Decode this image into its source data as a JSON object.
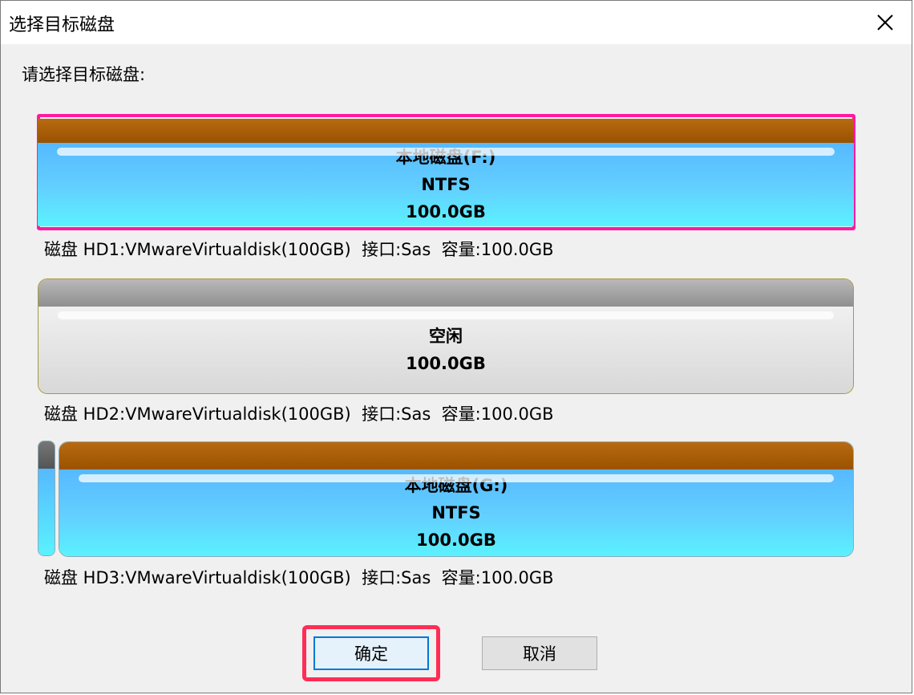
{
  "dialog": {
    "title": "选择目标磁盘",
    "prompt": "请选择目标磁盘:",
    "ok_label": "确定",
    "cancel_label": "取消"
  },
  "disks": [
    {
      "partition_label": "本地磁盘(F:)",
      "filesystem": "NTFS",
      "size": "100.0GB",
      "info": "磁盘 HD1:VMwareVirtualdisk(100GB)  接口:Sas  容量:100.0GB",
      "selected": true
    },
    {
      "partition_label": "空闲",
      "size": "100.0GB",
      "info": "磁盘 HD2:VMwareVirtualdisk(100GB)  接口:Sas  容量:100.0GB",
      "selected": false
    },
    {
      "partition_label": "本地磁盘(G:)",
      "filesystem": "NTFS",
      "size": "100.0GB",
      "info": "磁盘 HD3:VMwareVirtualdisk(100GB)  接口:Sas  容量:100.0GB",
      "selected": false
    }
  ],
  "colors": {
    "ntfs_bar": "#9a5200",
    "ntfs_fill": "#5ad0ff",
    "free_bar": "#9a9a9a",
    "free_fill": "#e0e0e0",
    "selection_highlight": "#ff1aa0",
    "button_highlight": "#ff2d55"
  },
  "icons": {
    "close": "close-icon"
  }
}
